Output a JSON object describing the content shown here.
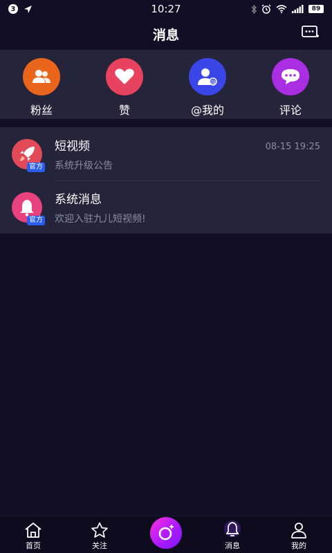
{
  "status_bar": {
    "sim": "3",
    "time": "10:27",
    "battery": "89"
  },
  "header": {
    "title": "消息"
  },
  "categories": [
    {
      "label": "粉丝",
      "icon": "fans-icon",
      "color": "#e8651b"
    },
    {
      "label": "赞",
      "icon": "heart-icon",
      "color": "#e8435e"
    },
    {
      "label": "@我的",
      "icon": "mention-icon",
      "color": "#3b46e8"
    },
    {
      "label": "评论",
      "icon": "comment-icon",
      "color": "#a92de3"
    }
  ],
  "messages": [
    {
      "title": "短视频",
      "preview": "系统升级公告",
      "time": "08-15 19:25",
      "badge": "官方",
      "icon": "rocket-icon"
    },
    {
      "title": "系统消息",
      "preview": "欢迎入驻九儿短视频!",
      "time": "",
      "badge": "官方",
      "icon": "bell-icon"
    }
  ],
  "bottom_nav": {
    "home": "首页",
    "follow": "关注",
    "messages": "消息",
    "profile": "我的"
  },
  "colors": {
    "background": "#120e25",
    "panel": "#25243a",
    "accent_gradient_start": "#ff2fd1",
    "accent_gradient_end": "#7a16ff",
    "badge": "#2a5df0"
  }
}
